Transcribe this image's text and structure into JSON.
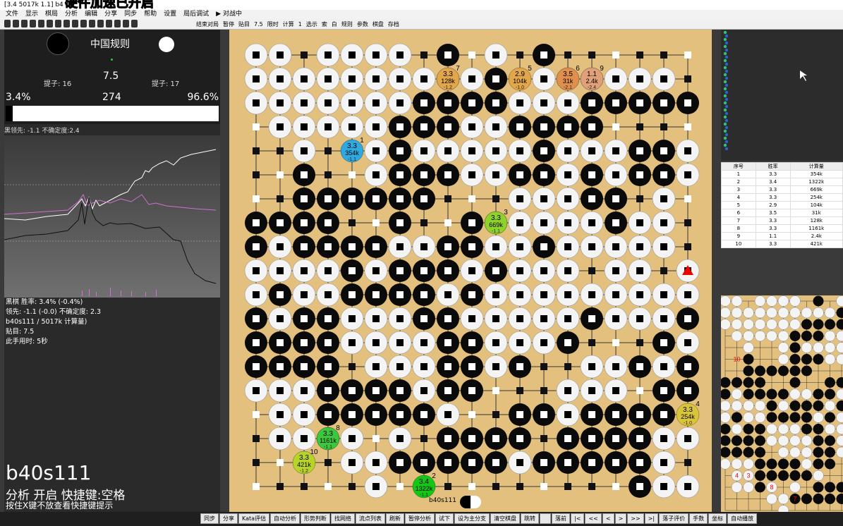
{
  "titlebar": {
    "title": "[3.4 5017k 1.1] b4",
    "banner": "硬件加速已开启"
  },
  "menu": [
    "文件",
    "显示",
    "棋局",
    "分析",
    "编辑",
    "分享",
    "同步",
    "帮助",
    "设置",
    "局后调试",
    "▶ 对战中"
  ],
  "toolbar": {
    "items": [
      "结束对局",
      "暂停",
      "贴目",
      "7.5",
      "限时",
      "计算",
      "1",
      "选示",
      "索",
      "白",
      "规则",
      "参数",
      "棋盘",
      "存档"
    ]
  },
  "left": {
    "rule": "中国规则",
    "komi": "7.5",
    "captures_black": "提子: 16",
    "captures_white": "提子: 17",
    "winrate_black": "3.4%",
    "move_number": "274",
    "winrate_white": "96.6%",
    "winrate_black_fraction": 0.034,
    "lead_line": "黑领先: -1.1 不确定度:2.4",
    "details": [
      "黑棋 胜率: 3.4% (-0.4%)",
      "领先: -1.1 (-0.0) 不确定度: 2.3",
      "b40s111 / 5017k 计算量)",
      "贴目: 7.5",
      "此手用时: 5秒"
    ],
    "network": "b40s111",
    "analysis": "分析 开启  快捷键:空格",
    "hint": "按住X键不放查看快捷键提示"
  },
  "board_net": "b40s111",
  "table": {
    "headers": [
      "序号",
      "胜率",
      "计算量"
    ],
    "rows": [
      [
        "1",
        "3.3",
        "354k"
      ],
      [
        "2",
        "3.4",
        "1322k"
      ],
      [
        "3",
        "3.3",
        "669k"
      ],
      [
        "4",
        "3.3",
        "254k"
      ],
      [
        "5",
        "2.9",
        "104k"
      ],
      [
        "6",
        "3.5",
        "31k"
      ],
      [
        "7",
        "3.3",
        "128k"
      ],
      [
        "8",
        "3.3",
        "1161k"
      ],
      [
        "9",
        "1.1",
        "2.4k"
      ],
      [
        "10",
        "3.3",
        "421k"
      ]
    ]
  },
  "candidates": [
    {
      "rank": "1",
      "wr": "3.3",
      "po": "354k",
      "sc": "-1.1",
      "col": 4.0,
      "row": 4.0,
      "color": "#2fa9e0"
    },
    {
      "rank": "2",
      "wr": "3.4",
      "po": "1322k",
      "sc": "-1.1",
      "col": 7.0,
      "row": 18.0,
      "color": "#14c714"
    },
    {
      "rank": "3",
      "wr": "3.3",
      "po": "669k",
      "sc": "-1.1",
      "col": 10.0,
      "row": 7.0,
      "color": "#8fd12d"
    },
    {
      "rank": "4",
      "wr": "3.3",
      "po": "254k",
      "sc": "-1.0",
      "col": 18.0,
      "row": 15.0,
      "color": "#d9c53a"
    },
    {
      "rank": "5",
      "wr": "2.9",
      "po": "104k",
      "sc": "-1.0",
      "col": 11.0,
      "row": 1.0,
      "color": "#e2a64b"
    },
    {
      "rank": "6",
      "wr": "3.5",
      "po": "31k",
      "sc": "-2.1",
      "col": 13.0,
      "row": 1.0,
      "color": "#e0904c"
    },
    {
      "rank": "7",
      "wr": "3.3",
      "po": "128k",
      "sc": "-1.2",
      "col": 8.0,
      "row": 1.0,
      "color": "#e2a64b"
    },
    {
      "rank": "8",
      "wr": "3.3",
      "po": "1161k",
      "sc": "-1.1",
      "col": 3.0,
      "row": 16.0,
      "color": "#3cc73c"
    },
    {
      "rank": "9",
      "wr": "1.1",
      "po": "2.4k",
      "sc": "-2.4",
      "col": 14.0,
      "row": 1.0,
      "color": "#e0a07a"
    },
    {
      "rank": "10",
      "wr": "3.3",
      "po": "421k",
      "sc": "-1.2",
      "col": 2.0,
      "row": 17.0,
      "color": "#b6d42a"
    }
  ],
  "mini_labels": [
    "10",
    "4",
    "3",
    "8",
    "7"
  ],
  "statusbar": [
    "同步",
    "分享",
    "Kata评估",
    "自动分析",
    "形势判断",
    "找网络",
    "流点列表",
    "刷新",
    "暂停分析",
    "试下",
    "设为主分支",
    "清空棋盘",
    "跳转",
    "",
    "落前",
    "|<",
    "<<",
    "<",
    ">",
    ">>",
    ">|",
    "落子评价",
    "手数",
    "坐标",
    "自动播放"
  ],
  "board": {
    "rows": [
      "WW.WWWW.B.W.B......",
      "WWWWWWWWWWB.WWWWWW.",
      "WWWWWWWBBBBWWWBBBBB",
      ".WWWWWBBBWWBBBB....",
      "..W..WBWWWWWBWWWBBW",
      "..B..WBBBWWBBWBWBBW",
      "..BBBBBB...WWWBB.W.",
      "BBBB..B..BBWWWWBWW.",
      "BWBBBBWWBBWWBWWWWW.",
      "WWWWBWBBBWBWWW.WW.W",
      "WBWWBBBBWBWWWWWWWWW",
      "BWBBWWWBBWWWWWBWWWB",
      "BBBBWWWWBBWWWB...BWB",
      "BBBB.WWWBBWB..WWBWB",
      "WWWBBBBWBB...WWW.BB",
      ".WWBBBBBW..BBWBBBB.",
      ".WWBW.W.BBBB.BBBBWW",
      "....WWBBBBBWBBBBBW.",
      ".....W..........BWW."
    ]
  }
}
